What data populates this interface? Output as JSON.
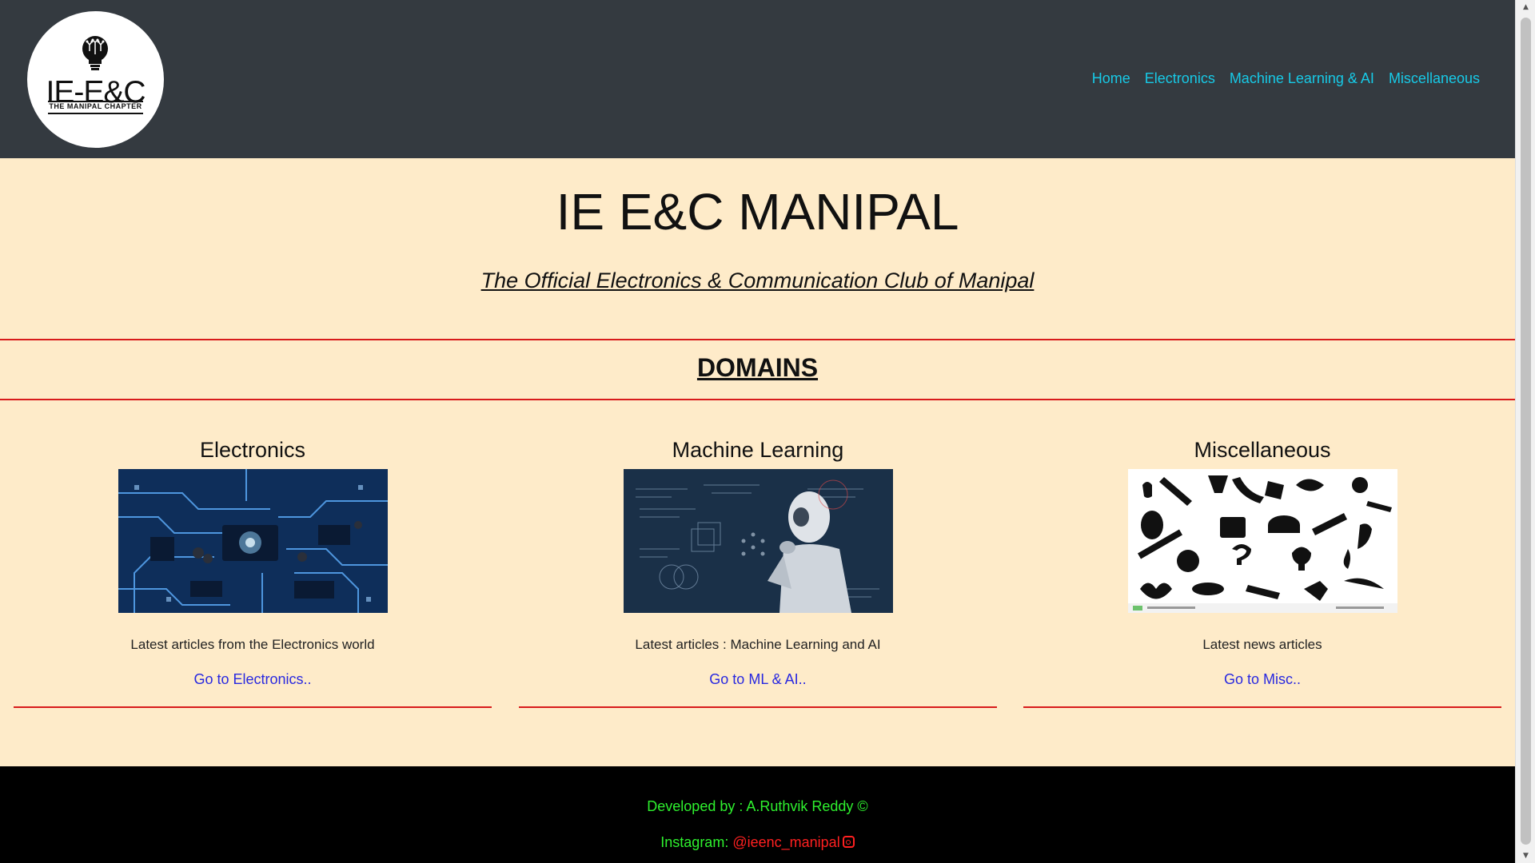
{
  "header": {
    "logo": {
      "text": "IE-E&C",
      "subtitle": "THE MANIPAL CHAPTER"
    },
    "nav": [
      "Home",
      "Electronics",
      "Machine Learning & AI",
      "Miscellaneous"
    ]
  },
  "hero": {
    "title": "IE E&C MANIPAL",
    "subtitle": "The Official Electronics & Communication Club of Manipal"
  },
  "domains": {
    "heading": "DOMAINS",
    "cards": [
      {
        "title": "Electronics",
        "image": "circuit-board-image",
        "description": "Latest articles from the Electronics world",
        "link": "Go to Electronics.."
      },
      {
        "title": "Machine Learning",
        "image": "robot-thinking-image",
        "description": "Latest articles : Machine Learning and AI",
        "link": "Go to ML & AI.."
      },
      {
        "title": "Miscellaneous",
        "image": "misc-icons-collage-image",
        "description": "Latest news articles",
        "link": "Go to Misc.."
      }
    ]
  },
  "footer": {
    "developed_by": "Developed by : A.Ruthvik Reddy ©",
    "instagram_label": "Instagram:",
    "instagram_handle": "@ieenc_manipal"
  },
  "colors": {
    "header_bg": "#343a40",
    "nav_link": "#17c9e6",
    "page_bg": "#feebc9",
    "rule": "#d81b1b",
    "card_link": "#2929e0",
    "footer_bg": "#000000",
    "footer_text": "#2ef02e",
    "footer_link": "#ff2020"
  }
}
